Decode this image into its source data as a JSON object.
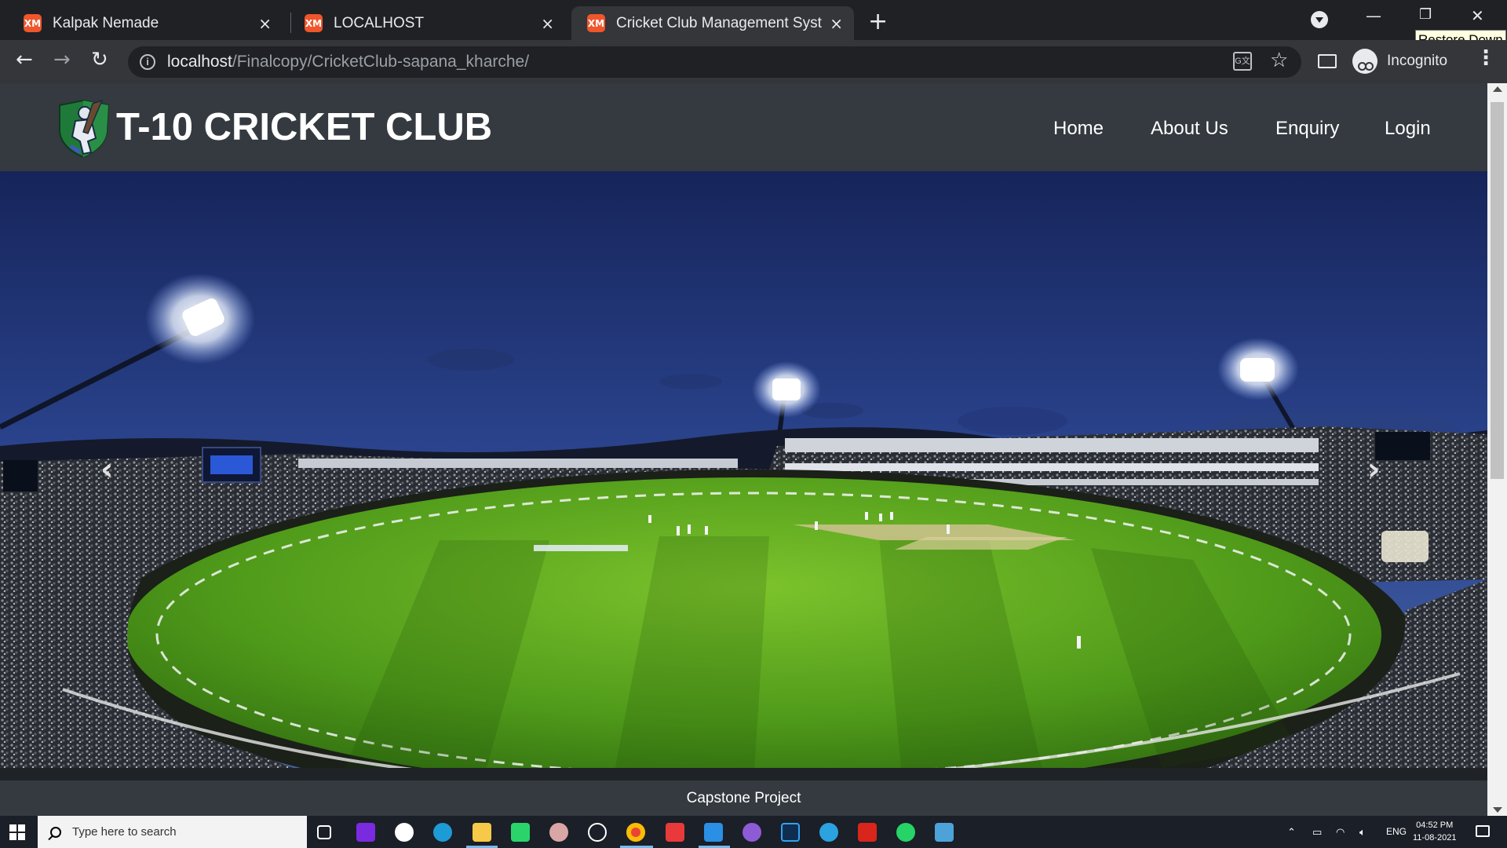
{
  "browser": {
    "tabs": [
      {
        "title": "Kalpak Nemade",
        "active": false
      },
      {
        "title": "LOCALHOST",
        "active": false
      },
      {
        "title": "Cricket Club Management System",
        "active": true
      }
    ],
    "favicon_glyph": "XM",
    "tooltip": "Restore Down",
    "url_host": "localhost",
    "url_path": "/Finalcopy/CricketClub-sapana_kharche/",
    "profile_label": "Incognito",
    "accent": "#f0562b"
  },
  "site": {
    "brand": "T-10 CRICKET CLUB",
    "nav": [
      "Home",
      "About Us",
      "Enquiry",
      "Login"
    ],
    "carousel": {
      "prev_glyph": "‹",
      "next_glyph": "›"
    },
    "footer": "Capstone Project"
  },
  "taskbar": {
    "search_placeholder": "Type here to search",
    "language": "ENG",
    "time": "04:52 PM",
    "date": "11-08-2021"
  }
}
